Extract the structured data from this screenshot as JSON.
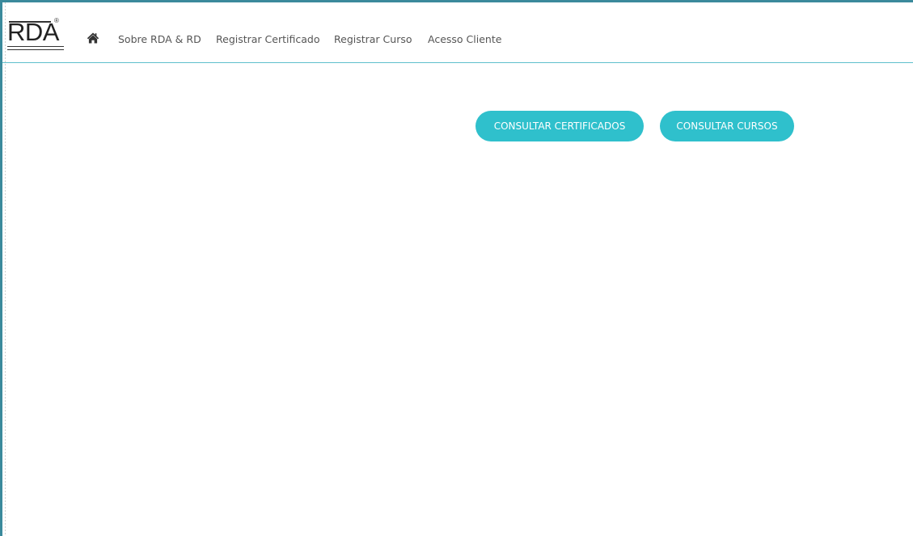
{
  "logo": {
    "text": "RDA",
    "registered_mark": "®"
  },
  "nav": {
    "home_icon": "home-icon",
    "items": [
      {
        "label": "Sobre RDA & RD"
      },
      {
        "label": "Registrar Certificado"
      },
      {
        "label": "Registrar Curso"
      },
      {
        "label": "Acesso Cliente"
      }
    ]
  },
  "actions": {
    "consultar_certificados": "CONSULTAR CERTIFICADOS",
    "consultar_cursos": "CONSULTAR CURSOS"
  },
  "colors": {
    "frame_border": "#3b8a9c",
    "navbar_divider": "#5fbfcc",
    "button_background": "#2fc0cc",
    "button_text": "#ffffff",
    "nav_text": "#555555"
  }
}
